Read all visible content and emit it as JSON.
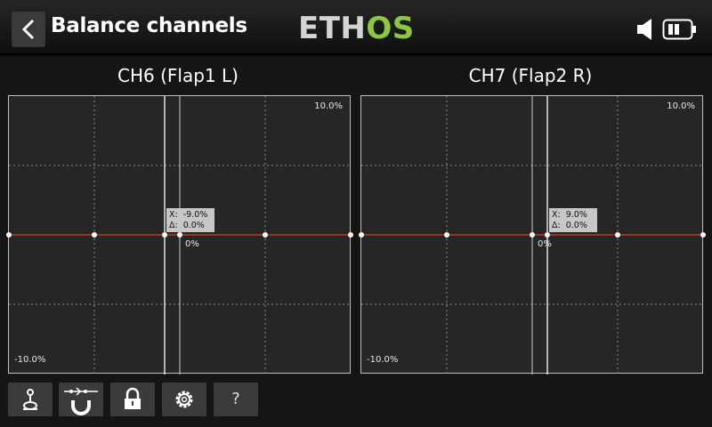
{
  "header": {
    "title": "Balance channels",
    "logo_part1": "ETH",
    "logo_part2": "OS"
  },
  "colors": {
    "logo_green": "#8fc641",
    "curve": "#e03a2a",
    "graph_bg": "#262626",
    "info_bg": "#c7c7c7"
  },
  "graphs": [
    {
      "title": "CH6 (Flap1 L)",
      "ymax": "10.0%",
      "ymin": "-10.0%",
      "center": "0%",
      "info_x": "X:  -9.0%",
      "info_d": "Δ:  0.0%"
    },
    {
      "title": "CH7 (Flap2 R)",
      "ymax": "10.0%",
      "ymin": "-10.0%",
      "center": "0%",
      "info_x": "X:  9.0%",
      "info_d": "Δ:  0.0%"
    }
  ],
  "toolbar": {
    "items": [
      "stick-icon",
      "magnet-icon",
      "lock-icon",
      "gear-icon"
    ],
    "help": "?"
  }
}
